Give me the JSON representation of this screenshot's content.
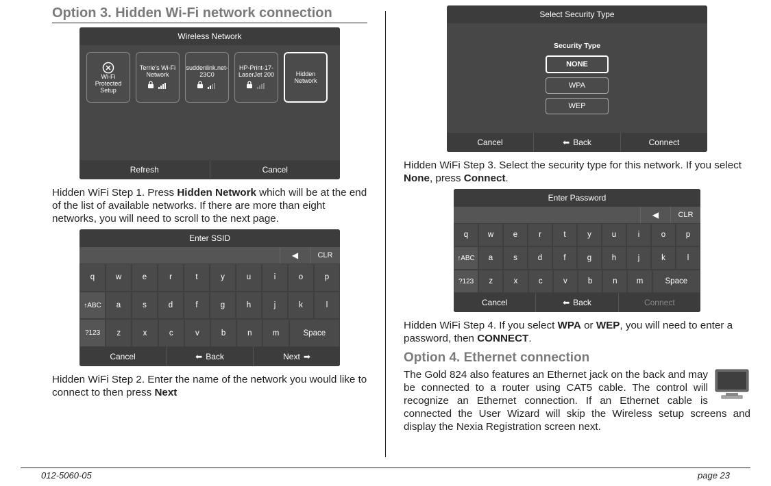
{
  "left": {
    "heading": "Option 3.  Hidden Wi-Fi network connection",
    "screen1": {
      "title": "Wireless Network",
      "tiles": [
        {
          "label": "Wi-Fi Protected Setup",
          "kind": "wps"
        },
        {
          "label": "Terrie's Wi-Fi Network",
          "kind": "net"
        },
        {
          "label": "suddenlink.net-23C0",
          "kind": "net"
        },
        {
          "label": "HP-Print-17-LaserJet 200",
          "kind": "net"
        },
        {
          "label": "Hidden Network",
          "kind": "hidden"
        }
      ],
      "bottom": {
        "left": "Refresh",
        "right": "Cancel"
      }
    },
    "step1_pre": "Hidden WiFi Step 1.  Press ",
    "step1_bold": "Hidden Network",
    "step1_post": " which will be at the end of the list of available networks. If there are more than eight networks, you will need to scroll to the next page.",
    "screen2": {
      "title": "Enter SSID",
      "clr": "CLR",
      "rows": [
        [
          "q",
          "w",
          "e",
          "r",
          "t",
          "y",
          "u",
          "i",
          "o",
          "p"
        ],
        [
          "↑ABC",
          "a",
          "s",
          "d",
          "f",
          "g",
          "h",
          "j",
          "k",
          "l"
        ],
        [
          "?123",
          "z",
          "x",
          "c",
          "v",
          "b",
          "n",
          "m",
          "Space"
        ]
      ],
      "bottom": {
        "left": "Cancel",
        "mid": "Back",
        "right": "Next"
      }
    },
    "step2_pre": "Hidden WiFi Step 2.  Enter the name of the network you would like to connect to then press ",
    "step2_bold": "Next"
  },
  "right": {
    "screen3": {
      "title": "Select Security Type",
      "label": "Security Type",
      "options": [
        "NONE",
        "WPA",
        "WEP"
      ],
      "bottom": {
        "left": "Cancel",
        "mid": "Back",
        "right": "Connect"
      }
    },
    "step3_pre": "Hidden WiFi Step 3.  Select the security type for this network. If you select ",
    "step3_bold1": "None",
    "step3_mid": ", press ",
    "step3_bold2": "Connect",
    "step3_post": ".",
    "screen4": {
      "title": "Enter Password",
      "clr": "CLR",
      "rows": [
        [
          "q",
          "w",
          "e",
          "r",
          "t",
          "y",
          "u",
          "i",
          "o",
          "p"
        ],
        [
          "↑ABC",
          "a",
          "s",
          "d",
          "f",
          "g",
          "h",
          "j",
          "k",
          "l"
        ],
        [
          "?123",
          "z",
          "x",
          "c",
          "v",
          "b",
          "n",
          "m",
          "Space"
        ]
      ],
      "bottom": {
        "left": "Cancel",
        "mid": "Back",
        "right": "Connect"
      }
    },
    "step4_pre": "Hidden WiFi Step 4.  If you select ",
    "step4_bold1": "WPA",
    "step4_mid1": " or ",
    "step4_bold2": "WEP",
    "step4_mid2": ", you will need to enter a password, then ",
    "step4_bold3": "CONNECT",
    "step4_post": ".",
    "opt4_heading": "Option 4. Ethernet connection",
    "opt4_body": "The Gold 824 also features an Ethernet jack on the back and may be connected to a router using CAT5 cable. The control will recognize an Ethernet connection.  If an Ethernet cable is connected the User Wizard will skip the Wireless setup screens and display the Nexia Registration screen next."
  },
  "footer": {
    "left": "012-5060-05",
    "right": "page 23"
  }
}
